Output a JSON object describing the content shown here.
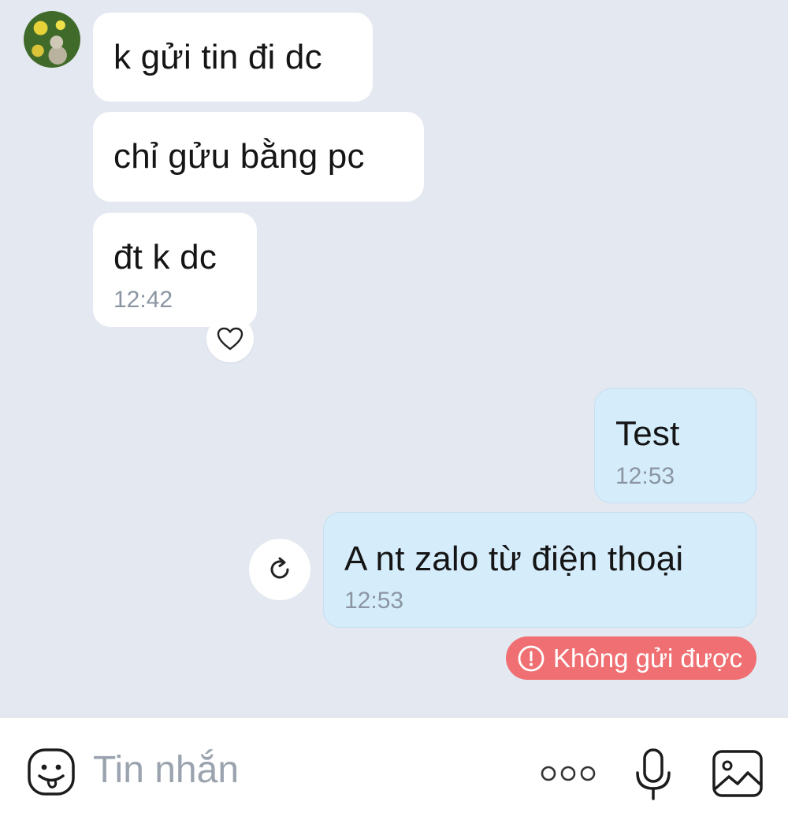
{
  "conversation": {
    "incoming": [
      {
        "text": "k gửi tin đi dc"
      },
      {
        "text": "chỉ gửu bằng pc"
      },
      {
        "text": "đt k dc",
        "time": "12:42"
      }
    ],
    "outgoing": [
      {
        "text": "Test",
        "time": "12:53"
      },
      {
        "text": "A nt zalo từ điện thoại",
        "time": "12:53"
      }
    ],
    "error_label": "Không gửi được",
    "colors": {
      "background": "#e3e8f1",
      "incoming_bubble": "#ffffff",
      "outgoing_bubble": "#d5ecfb",
      "error": "#ef6f72"
    }
  },
  "icons": {
    "reaction": "heart-icon",
    "retry": "retry-icon",
    "error": "alert-circle-icon",
    "emoji": "sticker-face-icon",
    "more": "more-dots-icon",
    "mic": "microphone-icon",
    "image": "image-icon"
  },
  "composer": {
    "placeholder": "Tin nhắn"
  }
}
